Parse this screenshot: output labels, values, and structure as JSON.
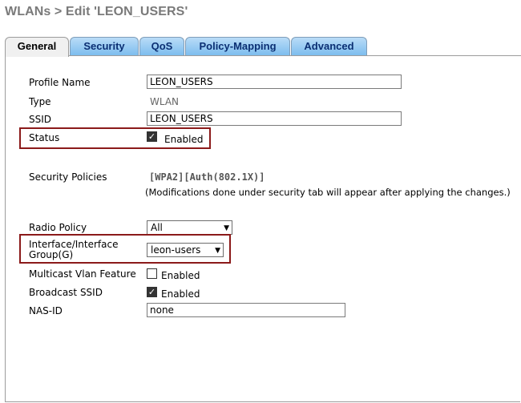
{
  "header": {
    "title": "WLANs > Edit   'LEON_USERS'"
  },
  "tabs": [
    {
      "label": "General",
      "active": true
    },
    {
      "label": "Security",
      "active": false
    },
    {
      "label": "QoS",
      "active": false
    },
    {
      "label": "Policy-Mapping",
      "active": false
    },
    {
      "label": "Advanced",
      "active": false
    }
  ],
  "general": {
    "profile_name": {
      "label": "Profile Name",
      "value": "LEON_USERS"
    },
    "type": {
      "label": "Type",
      "value": "WLAN"
    },
    "ssid": {
      "label": "SSID",
      "value": "LEON_USERS"
    },
    "status": {
      "label": "Status",
      "checked": true,
      "text": "Enabled"
    },
    "security_policies": {
      "label": "Security Policies",
      "value": "[WPA2][Auth(802.1X)]",
      "note": "(Modifications done under security tab will appear after applying the changes.)"
    },
    "radio_policy": {
      "label": "Radio Policy",
      "value": "All"
    },
    "interface_group": {
      "label_line1": "Interface/Interface",
      "label_line2": "Group(G)",
      "value": "leon-users"
    },
    "multicast_vlan": {
      "label": "Multicast Vlan Feature",
      "checked": false,
      "text": "Enabled"
    },
    "broadcast_ssid": {
      "label": "Broadcast SSID",
      "checked": true,
      "text": "Enabled"
    },
    "nas_id": {
      "label": "NAS-ID",
      "value": "none"
    }
  },
  "colors": {
    "highlight_border": "#8b1a1a",
    "tab_fill": "#7dbdee",
    "tab_text": "#0b2f73"
  }
}
